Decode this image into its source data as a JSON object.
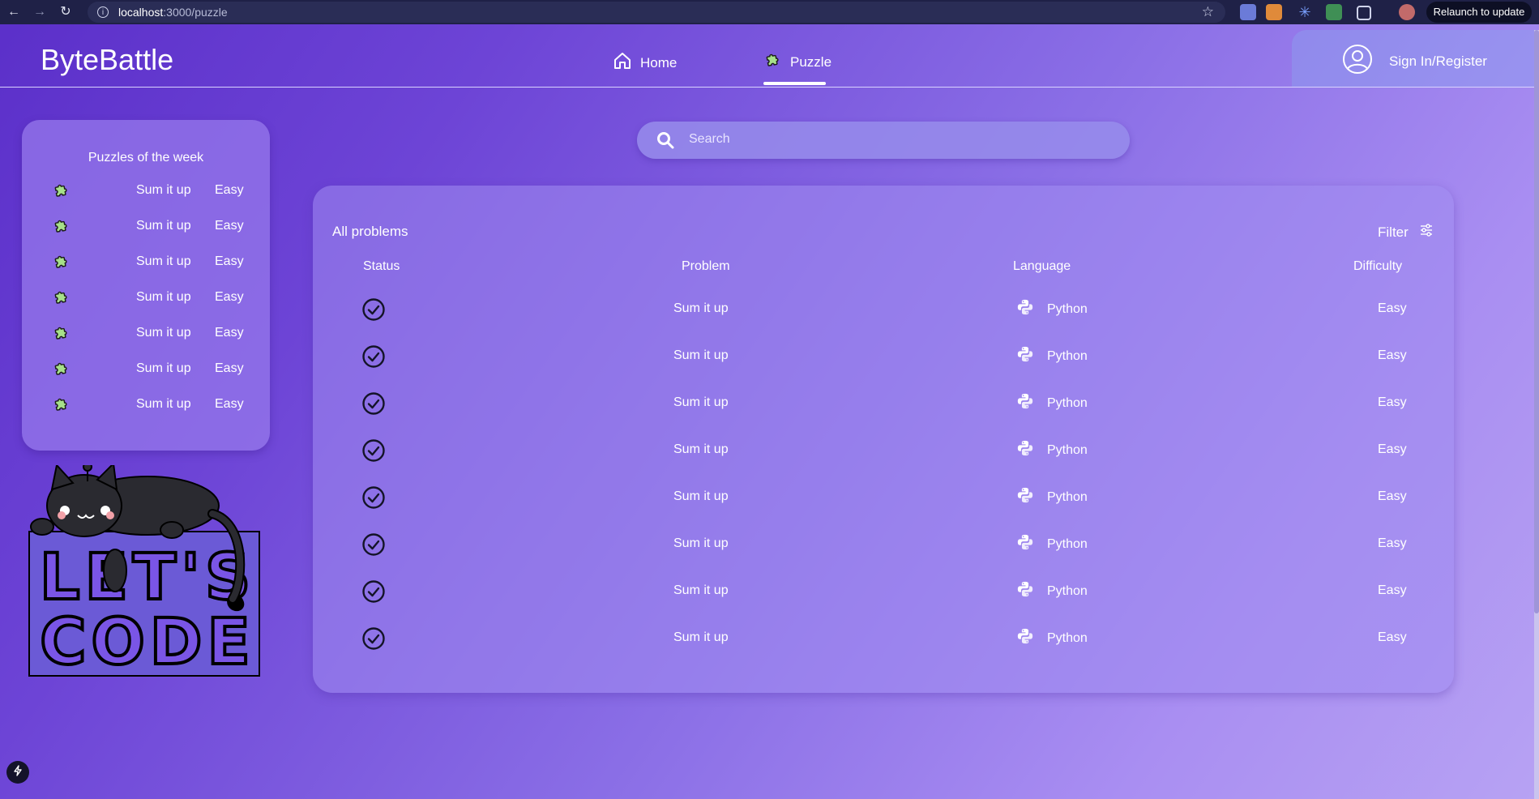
{
  "browser": {
    "url_host": "localhost",
    "url_path": ":3000/puzzle",
    "relaunch_label": "Relaunch to update"
  },
  "app": {
    "brand": "ByteBattle",
    "nav": [
      {
        "label": "Home",
        "icon": "home-icon"
      },
      {
        "label": "Puzzle",
        "icon": "puzzle-icon",
        "active": true
      }
    ],
    "signin_label": "Sign In/Register"
  },
  "week": {
    "title": "Puzzles of the week",
    "items": [
      {
        "name": "Sum it up",
        "difficulty": "Easy"
      },
      {
        "name": "Sum it up",
        "difficulty": "Easy"
      },
      {
        "name": "Sum it up",
        "difficulty": "Easy"
      },
      {
        "name": "Sum it up",
        "difficulty": "Easy"
      },
      {
        "name": "Sum it up",
        "difficulty": "Easy"
      },
      {
        "name": "Sum it up",
        "difficulty": "Easy"
      },
      {
        "name": "Sum it up",
        "difficulty": "Easy"
      }
    ]
  },
  "illustration": {
    "line1": "LET'S",
    "line2": "CODE"
  },
  "search": {
    "placeholder": "Search"
  },
  "problems": {
    "title": "All problems",
    "filter_label": "Filter",
    "columns": [
      "Status",
      "Problem",
      "Language",
      "Difficulty"
    ],
    "rows": [
      {
        "status": "solved",
        "problem": "Sum it up",
        "language": "Python",
        "difficulty": "Easy"
      },
      {
        "status": "solved",
        "problem": "Sum it up",
        "language": "Python",
        "difficulty": "Easy"
      },
      {
        "status": "solved",
        "problem": "Sum it up",
        "language": "Python",
        "difficulty": "Easy"
      },
      {
        "status": "solved",
        "problem": "Sum it up",
        "language": "Python",
        "difficulty": "Easy"
      },
      {
        "status": "solved",
        "problem": "Sum it up",
        "language": "Python",
        "difficulty": "Easy"
      },
      {
        "status": "solved",
        "problem": "Sum it up",
        "language": "Python",
        "difficulty": "Easy"
      },
      {
        "status": "solved",
        "problem": "Sum it up",
        "language": "Python",
        "difficulty": "Easy"
      },
      {
        "status": "solved",
        "problem": "Sum it up",
        "language": "Python",
        "difficulty": "Easy"
      }
    ]
  },
  "colors": {
    "accent": "#a7e08a",
    "chrome": "#1f2147"
  }
}
